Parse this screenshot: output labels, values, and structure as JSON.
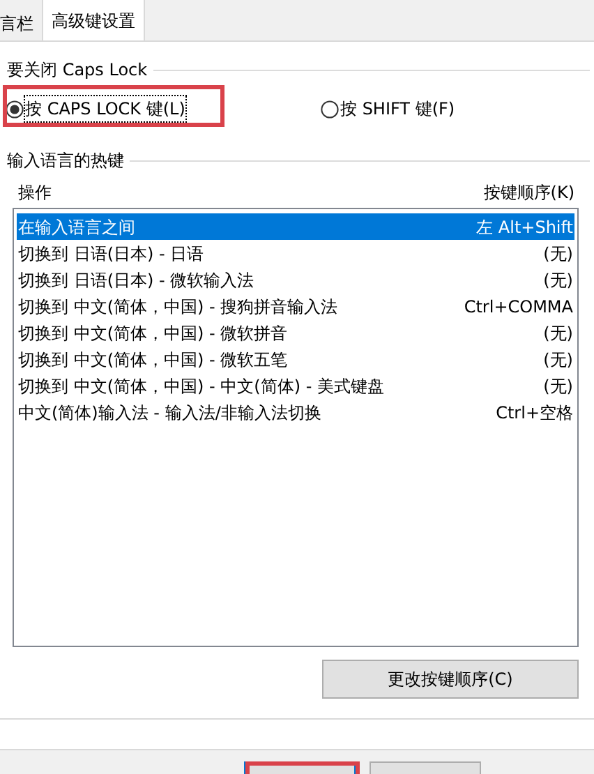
{
  "tabs": [
    {
      "label": "言栏",
      "selected": false
    },
    {
      "label": "高级键设置",
      "selected": true
    }
  ],
  "caps_lock_group": {
    "title": "要关闭 Caps Lock",
    "options": [
      {
        "label": "按 CAPS LOCK 键(L)",
        "selected": true,
        "highlighted": true
      },
      {
        "label": "按 SHIFT 键(F)",
        "selected": false,
        "highlighted": false
      }
    ]
  },
  "hotkeys_group": {
    "title": "输入语言的热键",
    "columns": [
      "操作",
      "按键顺序(K)"
    ],
    "rows": [
      {
        "action": "在输入语言之间",
        "keys": "左 Alt+Shift",
        "selected": true
      },
      {
        "action": "切换到 日语(日本) - 日语",
        "keys": "(无)",
        "selected": false
      },
      {
        "action": "切换到 日语(日本) - 微软输入法",
        "keys": "(无)",
        "selected": false
      },
      {
        "action": "切换到 中文(简体，中国) - 搜狗拼音输入法",
        "keys": "Ctrl+COMMA",
        "selected": false
      },
      {
        "action": "切换到 中文(简体，中国) - 微软拼音",
        "keys": "(无)",
        "selected": false
      },
      {
        "action": "切换到 中文(简体，中国) - 微软五笔",
        "keys": "(无)",
        "selected": false
      },
      {
        "action": "切换到 中文(简体，中国) - 中文(简体) - 美式键盘",
        "keys": "(无)",
        "selected": false
      },
      {
        "action": "中文(简体)输入法 - 输入法/非输入法切换",
        "keys": "Ctrl+空格",
        "selected": false
      }
    ],
    "change_button": "更改按键顺序(C)"
  },
  "footer_buttons": [
    {
      "focused": true,
      "highlighted": true
    },
    {
      "focused": false,
      "highlighted": false
    }
  ]
}
